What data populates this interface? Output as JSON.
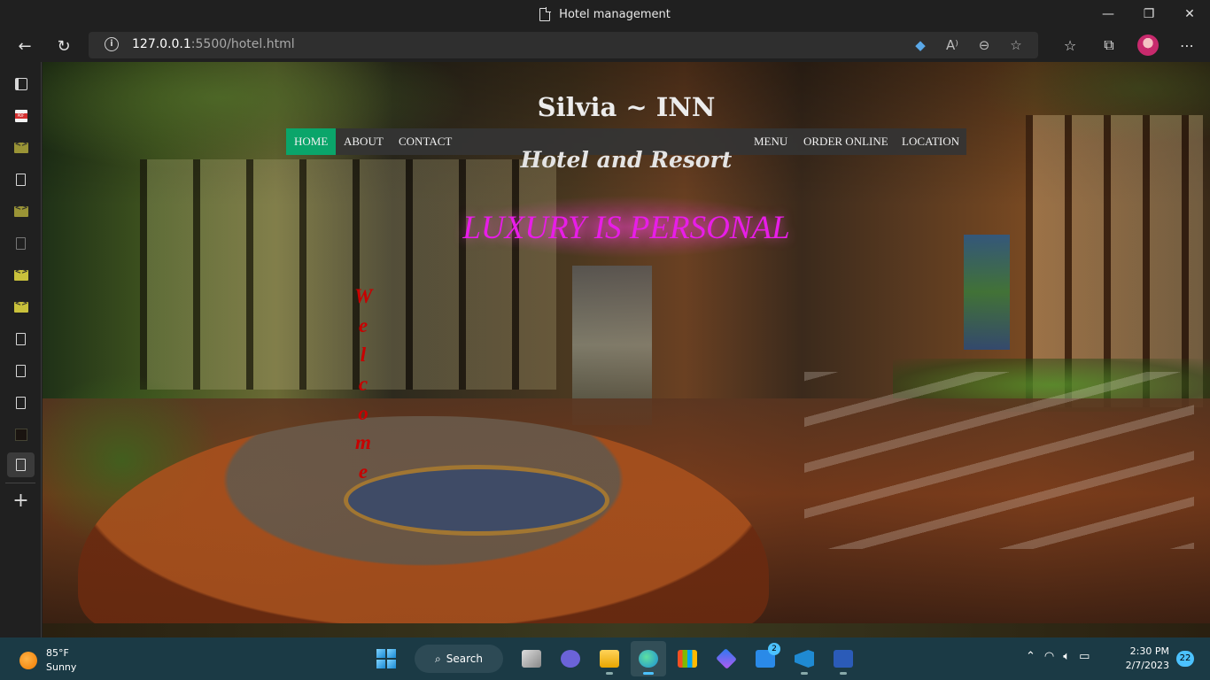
{
  "window": {
    "title": "Hotel management",
    "controls": {
      "minimize": "—",
      "restore": "❐",
      "close": "✕"
    }
  },
  "browser": {
    "url_host": "127.0.0.1",
    "url_rest": ":5500/hotel.html",
    "back_glyph": "←",
    "refresh_glyph": "↻",
    "info_glyph": "i",
    "address_icons": [
      "tag-icon",
      "read-aloud-icon",
      "zoom-out-icon",
      "add-favorite-icon"
    ],
    "toolbar_icons": [
      "favorites-icon",
      "collections-icon",
      "profile-avatar",
      "more-icon"
    ]
  },
  "page": {
    "title": "Silvia ~ INN",
    "nav_left": [
      "HOME",
      "ABOUT",
      "CONTACT"
    ],
    "nav_right": [
      "MENU",
      "ORDER ONLINE",
      "LOCATION"
    ],
    "active_nav": "HOME",
    "subtitle": "Hotel and Resort",
    "tagline": "LUXURY IS PERSONAL",
    "welcome_letters": [
      "W",
      "e",
      "l",
      "c",
      "o",
      "m",
      "e"
    ],
    "colors": {
      "active_nav": "#0aa56a",
      "tagline": "#e81de8",
      "welcome": "#c80000"
    }
  },
  "taskbar": {
    "weather": {
      "temp": "85°F",
      "condition": "Sunny"
    },
    "search_label": "Search",
    "apps": [
      "task-view",
      "teams-chat",
      "file-explorer",
      "edge",
      "store",
      "copilot",
      "mail",
      "vscode",
      "word"
    ],
    "mail_badge": "2",
    "clock": {
      "time": "2:30 PM",
      "date": "2/7/2023"
    },
    "notifications": "22"
  }
}
